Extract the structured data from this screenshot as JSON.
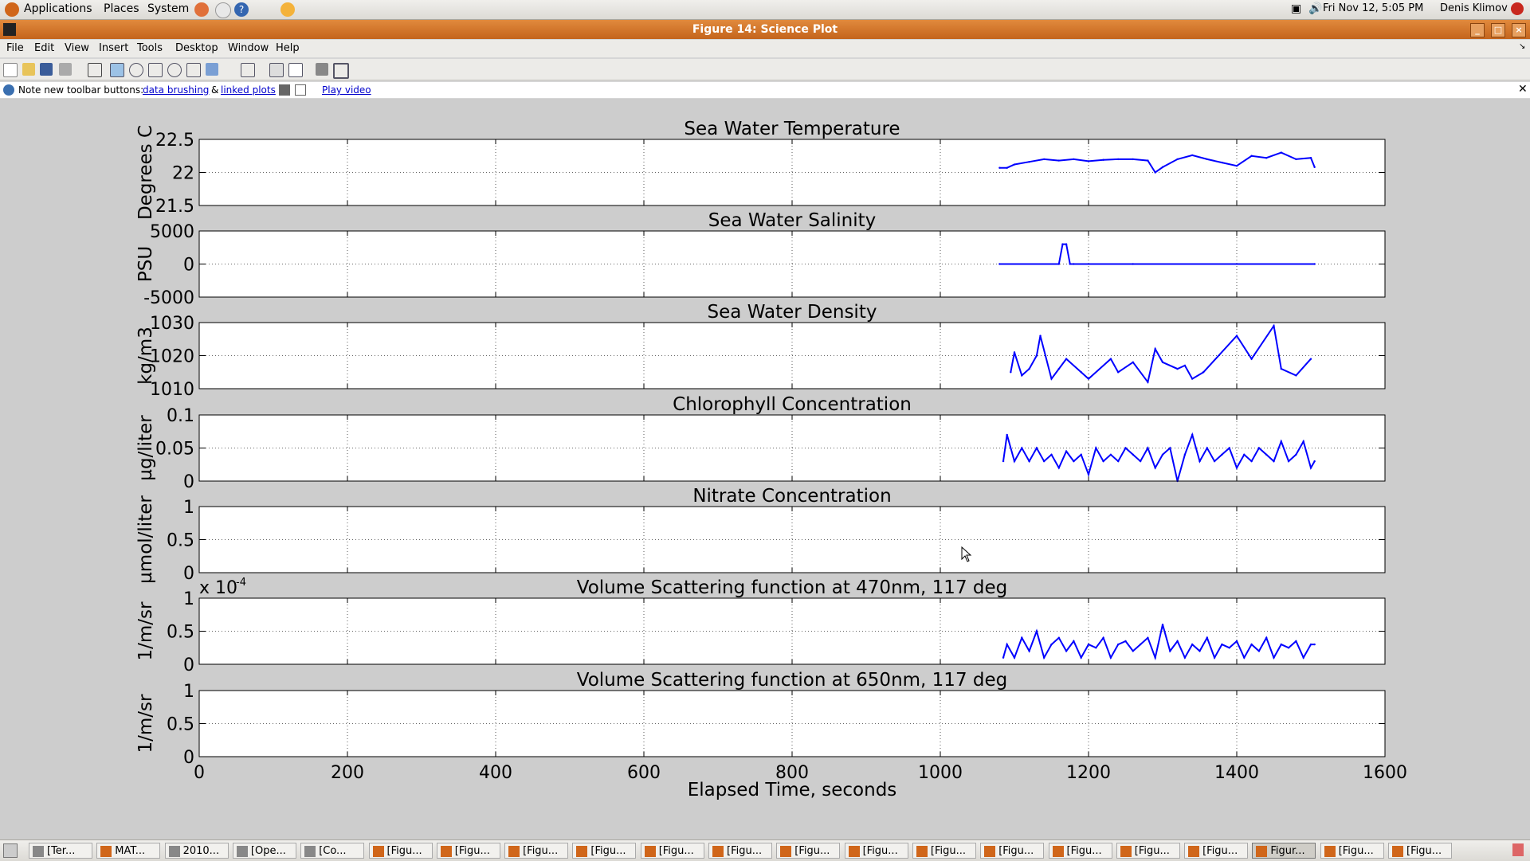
{
  "top_panel": {
    "menus": [
      "Applications",
      "Places",
      "System"
    ],
    "clock": "Fri Nov 12,  5:05 PM",
    "user": "Denis Klimov"
  },
  "window": {
    "title": "Figure 14: Science Plot",
    "menus": [
      "File",
      "Edit",
      "View",
      "Insert",
      "Tools",
      "Desktop",
      "Window",
      "Help"
    ]
  },
  "infobar": {
    "note": "Note new toolbar buttons:",
    "link1": "data brushing",
    "amp": "&",
    "link2": "linked plots",
    "video": "Play video"
  },
  "colors": {
    "line": "#0000ff",
    "title_bar": "#d2762a"
  },
  "chart_data": {
    "type": "line",
    "xlabel": "Elapsed Time,  seconds",
    "xlim": [
      0,
      1600
    ],
    "xticks": [
      "0",
      "200",
      "400",
      "600",
      "800",
      "1000",
      "1200",
      "1400",
      "1600"
    ],
    "grid": true,
    "panels": [
      {
        "title": "Sea Water Temperature",
        "ylabel": "Degrees C",
        "ylim": [
          21.5,
          22.5
        ],
        "yticks": [
          "21.5",
          "22",
          "22.5"
        ],
        "x": [
          1080,
          1090,
          1100,
          1120,
          1140,
          1160,
          1180,
          1200,
          1220,
          1240,
          1260,
          1280,
          1290,
          1300,
          1320,
          1340,
          1360,
          1380,
          1400,
          1420,
          1440,
          1460,
          1480,
          1500,
          1505
        ],
        "y": [
          22.07,
          22.07,
          22.12,
          22.16,
          22.2,
          22.18,
          22.2,
          22.17,
          22.19,
          22.2,
          22.2,
          22.18,
          22.0,
          22.08,
          22.2,
          22.26,
          22.2,
          22.15,
          22.1,
          22.25,
          22.22,
          22.3,
          22.2,
          22.22,
          22.08
        ]
      },
      {
        "title": "Sea Water Salinity",
        "ylabel": "PSU",
        "ylim": [
          -5000,
          5000
        ],
        "yticks": [
          "-5000",
          "0",
          "5000"
        ],
        "x": [
          1080,
          1160,
          1165,
          1170,
          1175,
          1180,
          1260,
          1505
        ],
        "y": [
          0,
          0,
          3000,
          3000,
          0,
          0,
          0,
          0
        ]
      },
      {
        "title": "Sea Water Density",
        "ylabel": "kg/m3",
        "ylim": [
          1010,
          1030
        ],
        "yticks": [
          "1010",
          "1020",
          "1030"
        ],
        "x": [
          1095,
          1100,
          1110,
          1120,
          1130,
          1135,
          1150,
          1160,
          1170,
          1190,
          1200,
          1230,
          1240,
          1260,
          1280,
          1290,
          1300,
          1320,
          1330,
          1340,
          1355,
          1400,
          1420,
          1450,
          1460,
          1480,
          1500
        ],
        "y": [
          1015,
          1021,
          1014,
          1016,
          1020,
          1026,
          1013,
          1016,
          1019,
          1015,
          1013,
          1019,
          1015,
          1018,
          1012,
          1022,
          1018,
          1016,
          1017,
          1013,
          1015,
          1026,
          1019,
          1029,
          1016,
          1014,
          1019
        ]
      },
      {
        "title": "Chlorophyll Concentration",
        "ylabel": "µg/liter",
        "ylim": [
          0,
          0.1
        ],
        "yticks": [
          "0",
          "0.05",
          "0.1"
        ],
        "x": [
          1085,
          1090,
          1100,
          1110,
          1120,
          1130,
          1140,
          1150,
          1160,
          1170,
          1180,
          1190,
          1200,
          1210,
          1220,
          1230,
          1240,
          1250,
          1260,
          1270,
          1280,
          1290,
          1300,
          1310,
          1320,
          1330,
          1340,
          1350,
          1360,
          1370,
          1380,
          1390,
          1400,
          1410,
          1420,
          1430,
          1440,
          1450,
          1460,
          1470,
          1480,
          1490,
          1500,
          1505
        ],
        "y": [
          0.03,
          0.07,
          0.03,
          0.05,
          0.03,
          0.05,
          0.03,
          0.04,
          0.02,
          0.045,
          0.03,
          0.04,
          0.01,
          0.05,
          0.03,
          0.04,
          0.03,
          0.05,
          0.04,
          0.03,
          0.05,
          0.02,
          0.04,
          0.05,
          0.0,
          0.04,
          0.07,
          0.03,
          0.05,
          0.03,
          0.04,
          0.05,
          0.02,
          0.04,
          0.03,
          0.05,
          0.04,
          0.03,
          0.06,
          0.03,
          0.04,
          0.06,
          0.02,
          0.03
        ]
      },
      {
        "title": "Nitrate Concentration",
        "ylabel": "µmol/liter",
        "ylim": [
          0,
          1
        ],
        "yticks": [
          "0",
          "0.5",
          "1"
        ],
        "x": [],
        "y": []
      },
      {
        "title": "Volume Scattering function at 470nm, 117 deg",
        "ylabel": "1/m/sr",
        "ylim": [
          0,
          1
        ],
        "yticks": [
          "0",
          "0.5",
          "1"
        ],
        "exponent_base": "x 10",
        "exponent_power": "-4",
        "x": [
          1085,
          1090,
          1100,
          1110,
          1120,
          1130,
          1140,
          1150,
          1160,
          1170,
          1180,
          1190,
          1200,
          1210,
          1220,
          1230,
          1240,
          1250,
          1260,
          1270,
          1280,
          1290,
          1300,
          1310,
          1320,
          1330,
          1340,
          1350,
          1360,
          1370,
          1380,
          1390,
          1400,
          1410,
          1420,
          1430,
          1440,
          1450,
          1460,
          1470,
          1480,
          1490,
          1500,
          1505
        ],
        "y": [
          0.1,
          0.3,
          0.1,
          0.4,
          0.2,
          0.5,
          0.1,
          0.3,
          0.4,
          0.2,
          0.35,
          0.1,
          0.3,
          0.25,
          0.4,
          0.1,
          0.3,
          0.35,
          0.2,
          0.3,
          0.4,
          0.1,
          0.6,
          0.2,
          0.35,
          0.1,
          0.3,
          0.2,
          0.4,
          0.1,
          0.3,
          0.25,
          0.35,
          0.1,
          0.3,
          0.2,
          0.4,
          0.1,
          0.3,
          0.25,
          0.35,
          0.1,
          0.3,
          0.3
        ]
      },
      {
        "title": "Volume Scattering function at 650nm, 117 deg",
        "ylabel": "1/m/sr",
        "ylim": [
          0,
          1
        ],
        "yticks": [
          "0",
          "0.5",
          "1"
        ],
        "x": [],
        "y": []
      }
    ]
  },
  "taskbar": {
    "items": [
      "[Ter...",
      "MAT...",
      "2010...",
      "[Ope...",
      "[Co...",
      "[Figu...",
      "[Figu...",
      "[Figu...",
      "[Figu...",
      "[Figu...",
      "[Figu...",
      "[Figu...",
      "[Figu...",
      "[Figu...",
      "[Figu...",
      "[Figu...",
      "[Figu...",
      "[Figu...",
      "Figur...",
      "[Figu...",
      "[Figu..."
    ],
    "active_index": 18
  }
}
